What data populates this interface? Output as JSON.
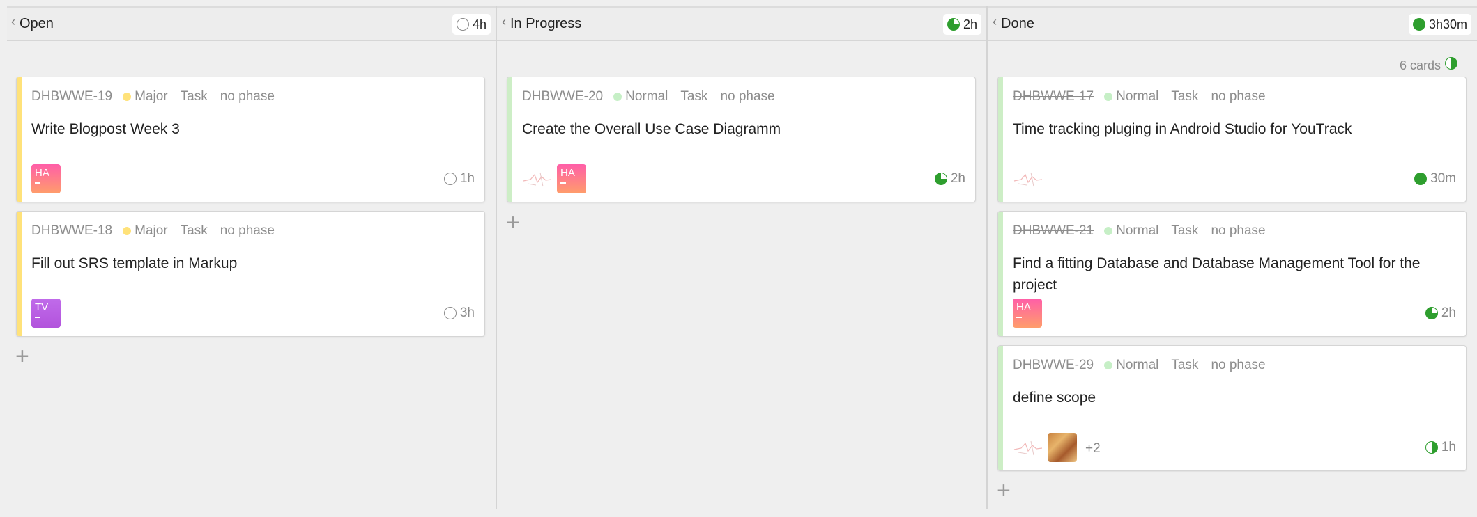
{
  "colors": {
    "major": "#ffe27a",
    "normal": "#c6efc6",
    "stripe_open": "#ffe27a",
    "stripe_other": "#cdeec6",
    "progress_green": "#2e9e2e"
  },
  "columns": [
    {
      "title": "Open",
      "estimate": "4h",
      "estimate_icon": "pie-empty-icon",
      "cards": [
        {
          "id": "DHBWWE-19",
          "priority": "Major",
          "type": "Task",
          "phase": "no phase",
          "summary": "Write Blogpost Week 3",
          "avatar": "HA",
          "time": "1h",
          "progress": 0
        },
        {
          "id": "DHBWWE-18",
          "priority": "Major",
          "type": "Task",
          "phase": "no phase",
          "summary": "Fill out SRS template in Markup",
          "avatar": "TV",
          "time": "3h",
          "progress": 0
        }
      ]
    },
    {
      "title": "In Progress",
      "estimate": "2h",
      "estimate_icon": "pie-three-quarter-icon",
      "cards": [
        {
          "id": "DHBWWE-20",
          "priority": "Normal",
          "type": "Task",
          "phase": "no phase",
          "summary": "Create the Overall Use Case Diagramm",
          "avatar": "HA",
          "time": "2h",
          "progress": 0.75
        }
      ]
    },
    {
      "title": "Done",
      "estimate": "3h30m",
      "estimate_icon": "pie-full-icon",
      "cards_count": "6 cards",
      "cards": [
        {
          "id": "DHBWWE-17",
          "priority": "Normal",
          "type": "Task",
          "phase": "no phase",
          "summary": "Time tracking pluging in Android Studio for YouTrack",
          "time": "30m",
          "progress": 1
        },
        {
          "id": "DHBWWE-21",
          "priority": "Normal",
          "type": "Task",
          "phase": "no phase",
          "summary": "Find a fitting Database and Database Management Tool for the project",
          "avatar": "HA",
          "time": "2h",
          "progress": 0.75
        },
        {
          "id": "DHBWWE-29",
          "priority": "Normal",
          "type": "Task",
          "phase": "no phase",
          "summary": "define scope",
          "more": "+2",
          "time": "1h",
          "progress": 0.5
        }
      ]
    }
  ]
}
